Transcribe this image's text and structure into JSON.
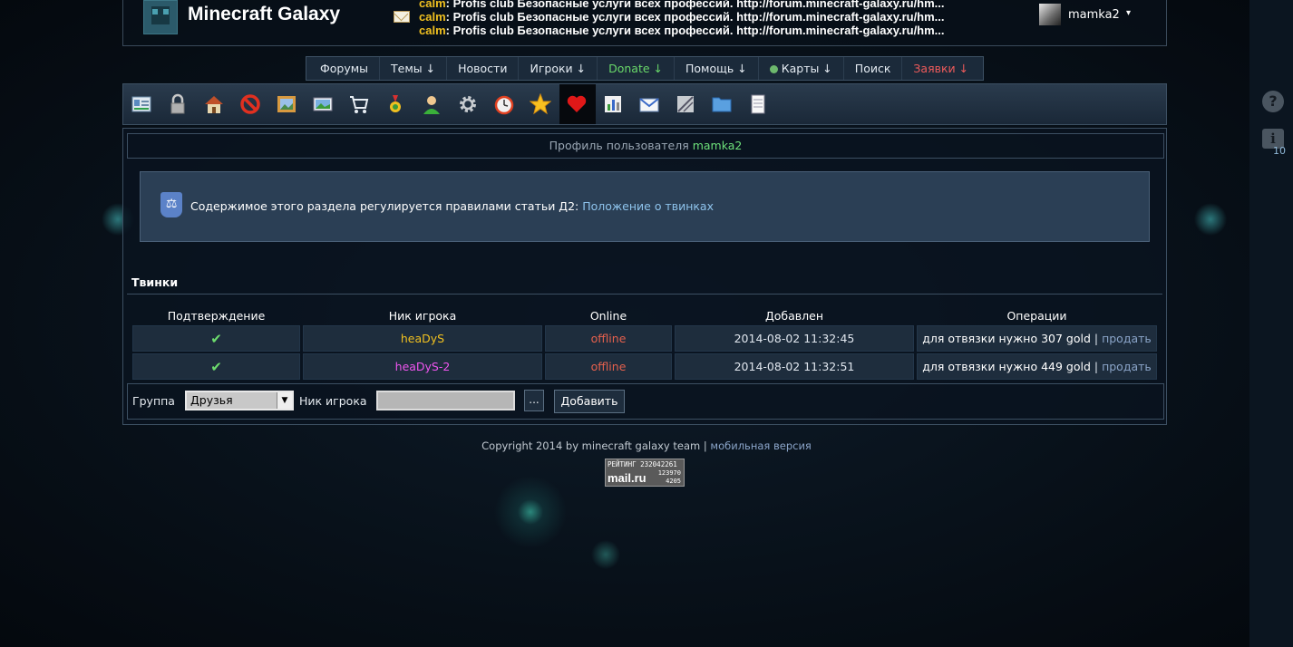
{
  "header": {
    "site_title": "Minecraft Galaxy",
    "news": [
      {
        "who": "calm",
        "text": ": Profis club Безопасные услуги всех профессий. http://forum.minecraft-galaxy.ru/hm..."
      },
      {
        "who": "calm",
        "text": ": Profis club Безопасные услуги всех профессий. http://forum.minecraft-galaxy.ru/hm..."
      },
      {
        "who": "calm",
        "text": ": Profis club Безопасные услуги всех профессий. http://forum.minecraft-galaxy.ru/hm..."
      }
    ],
    "username": "mamka2",
    "user_caret": "▾"
  },
  "nav": [
    {
      "label": "Форумы"
    },
    {
      "label": "Темы ↓"
    },
    {
      "label": "Новости"
    },
    {
      "label": "Игроки ↓"
    },
    {
      "label": "Donate ↓"
    },
    {
      "label": "Помощь ↓"
    },
    {
      "label": "Карты ↓"
    },
    {
      "label": "Поиск"
    },
    {
      "label": "Заявки ↓"
    }
  ],
  "toolbar_icons": [
    "profile-card-icon",
    "lock-icon",
    "home-icon",
    "ban-icon",
    "picture-frame-icon",
    "landscape-icon",
    "cart-icon",
    "medal-icon",
    "user-icon",
    "gear-icon",
    "alarm-clock-icon",
    "star-icon",
    "heart-icon",
    "bar-chart-icon",
    "mail-icon",
    "ruler-icon",
    "folder-icon",
    "notepad-icon"
  ],
  "profile": {
    "heading_prefix": "Профиль пользователя ",
    "heading_user": "mamka2"
  },
  "notice": {
    "text": "Содержимое этого раздела регулируется правилами статьи Д2: ",
    "link": "Положение о твинках"
  },
  "twinks": {
    "title": "Твинки",
    "columns": [
      "Подтверждение",
      "Ник игрока",
      "Online",
      "Добавлен",
      "Операции"
    ],
    "rows": [
      {
        "confirmed": "✔",
        "nick": "heaDyS",
        "online": "offline",
        "added": "2014-08-02 11:32:45",
        "ops_text": "для отвязки нужно 307 gold",
        "sep": " | ",
        "ops_link": "продать"
      },
      {
        "confirmed": "✔",
        "nick": "heaDyS-2",
        "online": "offline",
        "added": "2014-08-02 11:32:51",
        "ops_text": "для отвязки нужно 449 gold",
        "sep": " | ",
        "ops_link": "продать"
      }
    ]
  },
  "add_form": {
    "group_label": "Группа",
    "group_value": "Друзья",
    "nick_label": "Ник игрока",
    "nick_value": "",
    "dots_label": "...",
    "add_label": "Добавить"
  },
  "footer": {
    "copyright": "Copyright 2014 by minecraft galaxy team | ",
    "mobile": "мобильная версия"
  },
  "counter": {
    "line1": "РЕЙТИНГ 232042261",
    "brand": "mail.ru",
    "n1": "123970",
    "n2": "4205"
  },
  "side": {
    "help_icon": "?",
    "info_icon": "i",
    "info_count": "10"
  }
}
